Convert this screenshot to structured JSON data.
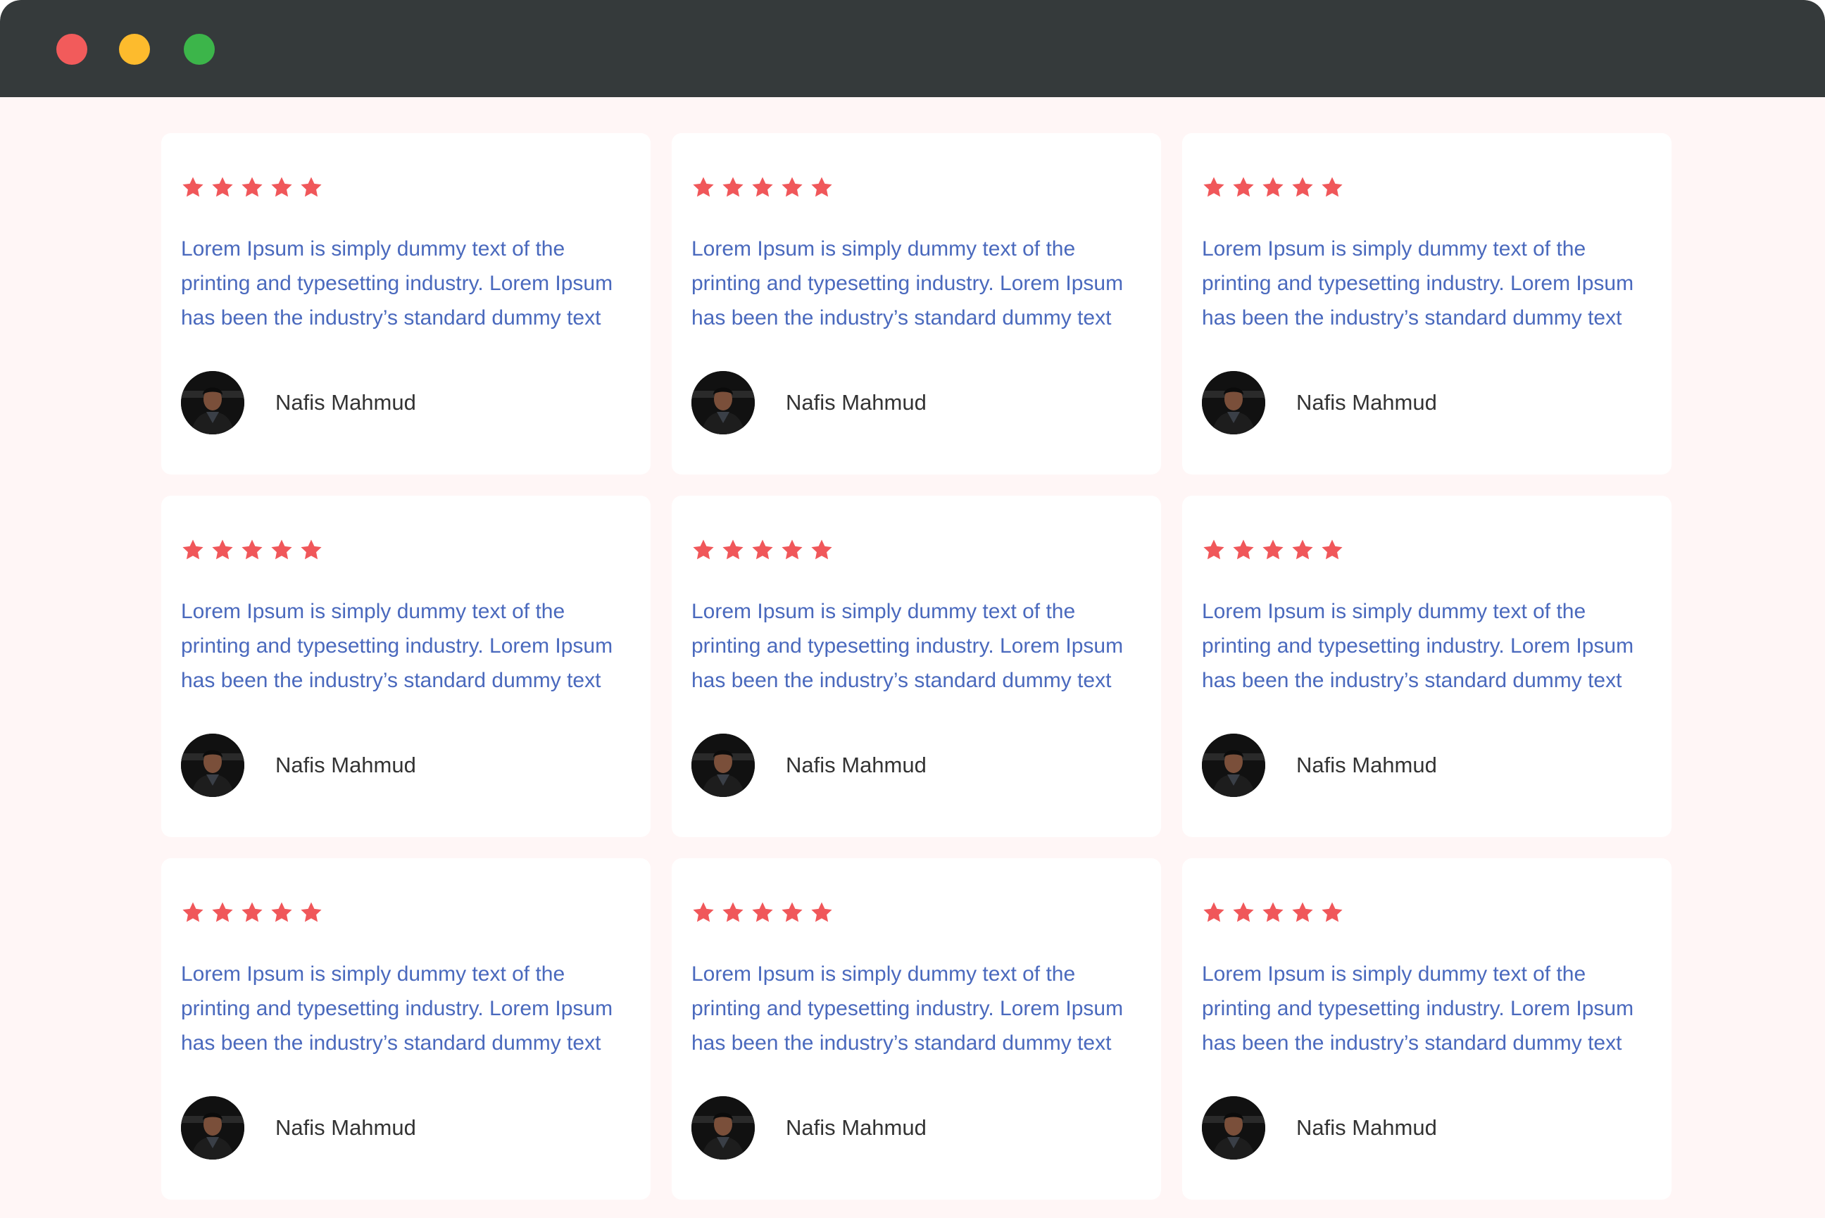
{
  "window": {
    "controls": [
      {
        "name": "close",
        "color": "#f25b5b"
      },
      {
        "name": "minimize",
        "color": "#fdbb2d"
      },
      {
        "name": "maximize",
        "color": "#3cb54a"
      }
    ]
  },
  "colors": {
    "star": "#f0575a",
    "quote_text": "#4a69bd",
    "author_text": "#333333",
    "page_background": "#fff6f6",
    "titlebar": "#353a3b"
  },
  "testimonials": [
    {
      "rating": 5,
      "quote": "Lorem Ipsum is simply dummy text of the printing and typesetting industry. Lorem Ipsum has been the industry’s standard dummy text",
      "author": "Nafis Mahmud",
      "avatar_icon": "person-photo"
    },
    {
      "rating": 5,
      "quote": "Lorem Ipsum is simply dummy text of the printing and typesetting industry. Lorem Ipsum has been the industry’s standard dummy text",
      "author": "Nafis Mahmud",
      "avatar_icon": "person-photo"
    },
    {
      "rating": 5,
      "quote": "Lorem Ipsum is simply dummy text of the printing and typesetting industry. Lorem Ipsum has been the industry’s standard dummy text",
      "author": "Nafis Mahmud",
      "avatar_icon": "person-photo"
    },
    {
      "rating": 5,
      "quote": "Lorem Ipsum is simply dummy text of the printing and typesetting industry. Lorem Ipsum has been the industry’s standard dummy text",
      "author": "Nafis Mahmud",
      "avatar_icon": "person-photo"
    },
    {
      "rating": 5,
      "quote": "Lorem Ipsum is simply dummy text of the printing and typesetting industry. Lorem Ipsum has been the industry’s standard dummy text",
      "author": "Nafis Mahmud",
      "avatar_icon": "person-photo"
    },
    {
      "rating": 5,
      "quote": "Lorem Ipsum is simply dummy text of the printing and typesetting industry. Lorem Ipsum has been the industry’s standard dummy text",
      "author": "Nafis Mahmud",
      "avatar_icon": "person-photo"
    },
    {
      "rating": 5,
      "quote": "Lorem Ipsum is simply dummy text of the printing and typesetting industry. Lorem Ipsum has been the industry’s standard dummy text",
      "author": "Nafis Mahmud",
      "avatar_icon": "person-photo"
    },
    {
      "rating": 5,
      "quote": "Lorem Ipsum is simply dummy text of the printing and typesetting industry. Lorem Ipsum has been the industry’s standard dummy text",
      "author": "Nafis Mahmud",
      "avatar_icon": "person-photo"
    },
    {
      "rating": 5,
      "quote": "Lorem Ipsum is simply dummy text of the printing and typesetting industry. Lorem Ipsum has been the industry’s standard dummy text",
      "author": "Nafis Mahmud",
      "avatar_icon": "person-photo"
    }
  ]
}
